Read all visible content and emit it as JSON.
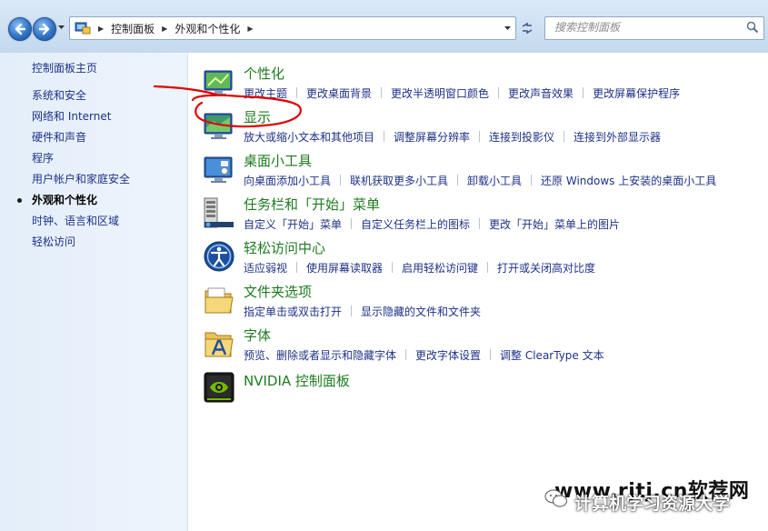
{
  "address_bar": {
    "breadcrumbs": [
      "控制面板",
      "外观和个性化"
    ],
    "search_placeholder": "搜索控制面板"
  },
  "sidebar": {
    "home": "控制面板主页",
    "items": [
      {
        "label": "系统和安全",
        "current": false
      },
      {
        "label": "网络和 Internet",
        "current": false
      },
      {
        "label": "硬件和声音",
        "current": false
      },
      {
        "label": "程序",
        "current": false
      },
      {
        "label": "用户帐户和家庭安全",
        "current": false
      },
      {
        "label": "外观和个性化",
        "current": true
      },
      {
        "label": "时钟、语言和区域",
        "current": false
      },
      {
        "label": "轻松访问",
        "current": false
      }
    ]
  },
  "categories": [
    {
      "title": "个性化",
      "icon": "personalization-icon",
      "links": [
        "更改主题",
        "更改桌面背景",
        "更改半透明窗口颜色",
        "更改声音效果",
        "更改屏幕保护程序"
      ]
    },
    {
      "title": "显示",
      "icon": "display-icon",
      "links": [
        "放大或缩小文本和其他项目",
        "调整屏幕分辨率",
        "连接到投影仪",
        "连接到外部显示器"
      ]
    },
    {
      "title": "桌面小工具",
      "icon": "gadgets-icon",
      "links": [
        "向桌面添加小工具",
        "联机获取更多小工具",
        "卸载小工具",
        "还原 Windows 上安装的桌面小工具"
      ]
    },
    {
      "title": "任务栏和「开始」菜单",
      "icon": "taskbar-icon",
      "links": [
        "自定义「开始」菜单",
        "自定义任务栏上的图标",
        "更改「开始」菜单上的图片"
      ]
    },
    {
      "title": "轻松访问中心",
      "icon": "ease-of-access-icon",
      "links": [
        "适应弱视",
        "使用屏幕读取器",
        "启用轻松访问键",
        "打开或关闭高对比度"
      ]
    },
    {
      "title": "文件夹选项",
      "icon": "folder-options-icon",
      "links": [
        "指定单击或双击打开",
        "显示隐藏的文件和文件夹"
      ]
    },
    {
      "title": "字体",
      "icon": "fonts-icon",
      "links": [
        "预览、删除或者显示和隐藏字体",
        "更改字体设置",
        "调整 ClearType 文本"
      ]
    },
    {
      "title": "NVIDIA 控制面板",
      "icon": "nvidia-icon",
      "links": []
    }
  ],
  "colors": {
    "link": "#1e3287",
    "category_title": "#1e7b1e",
    "annotation": "#e00000"
  },
  "watermark": {
    "text": "www.rjtj.cn软荐网",
    "subtext": "计算机学习资源大学"
  }
}
